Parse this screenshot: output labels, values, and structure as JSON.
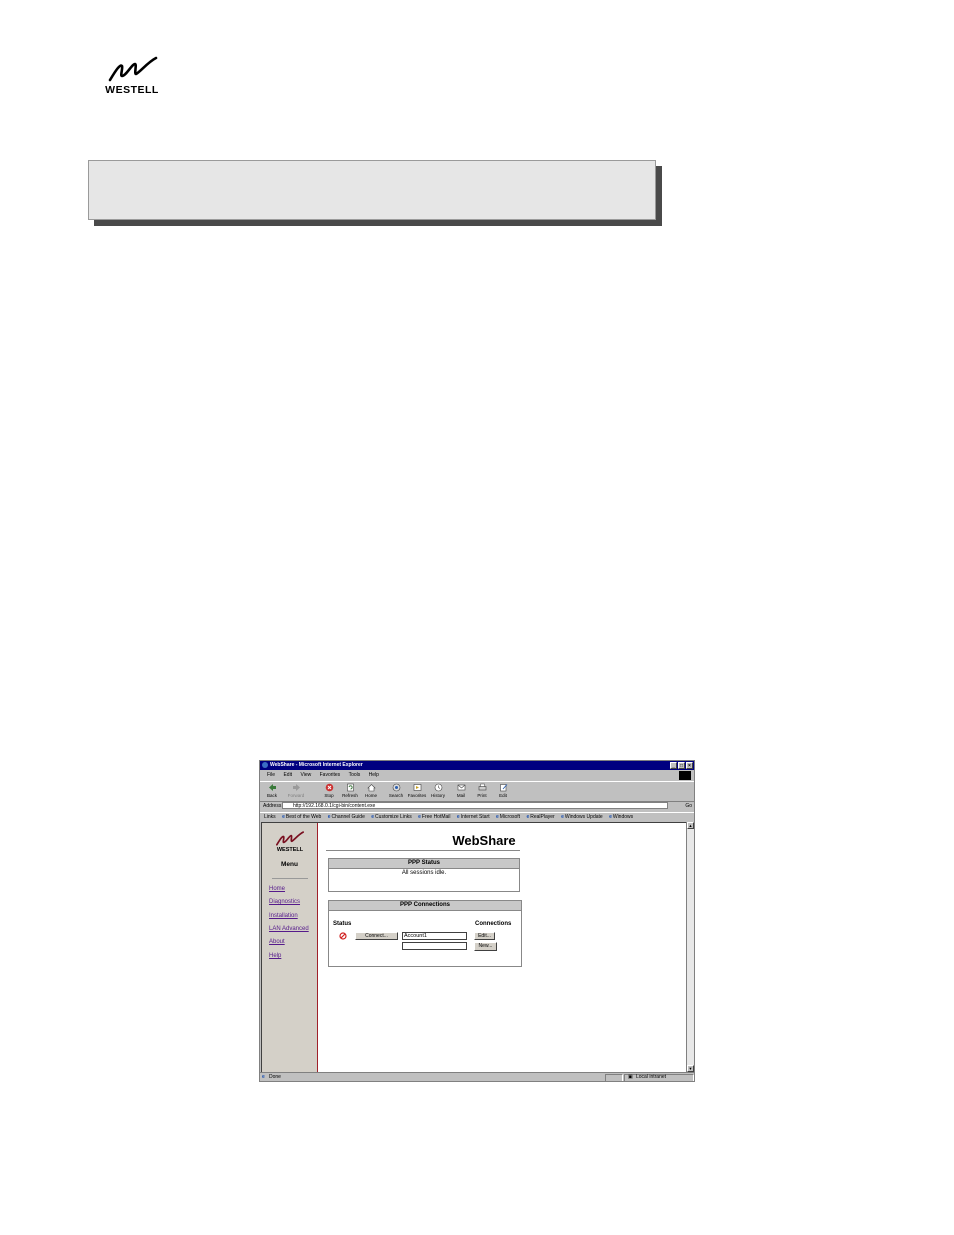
{
  "document": {
    "logo_text": "WESTELL",
    "title_box_text": ""
  },
  "browser": {
    "window_title": "WebShare - Microsoft Internet Explorer",
    "window_buttons": [
      "_",
      "□",
      "×"
    ],
    "menu": [
      "File",
      "Edit",
      "View",
      "Favorites",
      "Tools",
      "Help"
    ],
    "toolbar": [
      {
        "label": "Back",
        "icon": "back-arrow-icon"
      },
      {
        "label": "Forward",
        "icon": "forward-arrow-icon"
      },
      {
        "label": "Stop",
        "icon": "stop-icon"
      },
      {
        "label": "Refresh",
        "icon": "refresh-icon"
      },
      {
        "label": "Home",
        "icon": "home-icon"
      },
      {
        "label": "Search",
        "icon": "search-icon"
      },
      {
        "label": "Favorites",
        "icon": "favorites-icon"
      },
      {
        "label": "History",
        "icon": "history-icon"
      },
      {
        "label": "Mail",
        "icon": "mail-icon"
      },
      {
        "label": "Print",
        "icon": "print-icon"
      },
      {
        "label": "Edit",
        "icon": "edit-icon"
      }
    ],
    "address_label": "Address",
    "address_url": "http://192.168.0.1/cgi-bin/content.exe",
    "go_label": "Go",
    "links_label": "Links",
    "links": [
      "Best of the Web",
      "Channel Guide",
      "Customize Links",
      "Free HotMail",
      "Internet Start",
      "Microsoft",
      "RealPlayer",
      "Windows Update",
      "Windows"
    ],
    "status_text": "Done",
    "zone_text": "Local intranet"
  },
  "webshare": {
    "logo_text": "WESTELL",
    "menu_heading": "Menu",
    "nav": [
      "Home",
      "Diagnostics",
      "Installation",
      "LAN Advanced",
      "About",
      "Help"
    ],
    "page_title": "WebShare",
    "ppp_status": {
      "heading": "PPP Status",
      "message": "All sessions idle."
    },
    "ppp_connections": {
      "heading": "PPP Connections",
      "status_label": "Status",
      "connections_label": "Connections",
      "connect_button": "Connect...",
      "account_value": "Account1",
      "edit_button": "Edit...",
      "new_button": "New..."
    }
  }
}
